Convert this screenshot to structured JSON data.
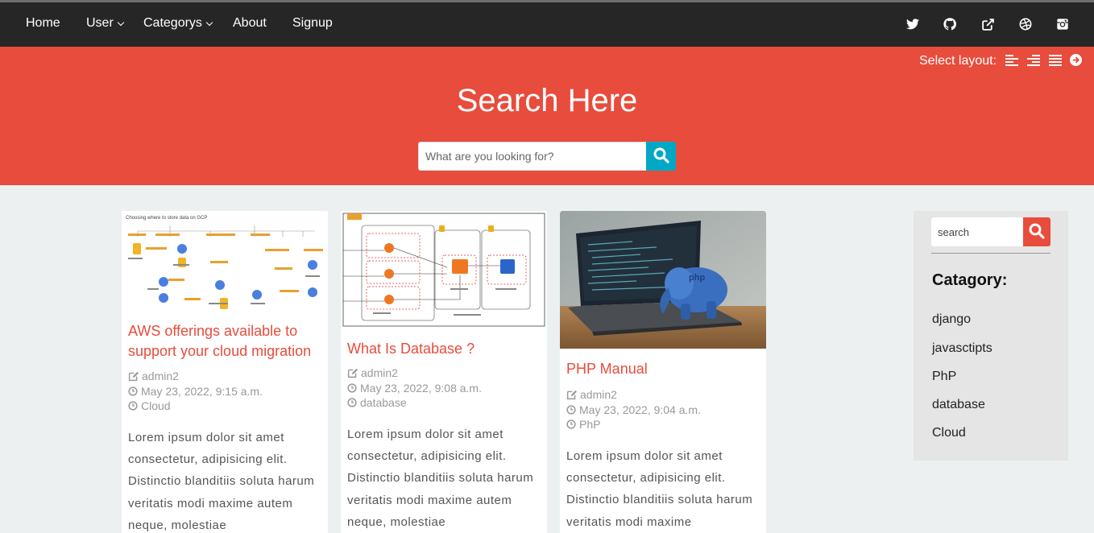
{
  "nav": {
    "items": [
      {
        "label": "Home",
        "dropdown": false
      },
      {
        "label": "User",
        "dropdown": true
      },
      {
        "label": "Categorys",
        "dropdown": true
      },
      {
        "label": "About",
        "dropdown": false
      },
      {
        "label": "Signup",
        "dropdown": false
      }
    ],
    "social_icons": [
      "twitter-icon",
      "github-icon",
      "external-link-icon",
      "dribbble-icon",
      "instagram-icon"
    ]
  },
  "hero": {
    "layout_label": "Select layout:",
    "layout_icons": [
      "align-left-icon",
      "align-right-icon",
      "align-justify-icon",
      "arrow-circle-right-icon"
    ],
    "title": "Search Here",
    "search_placeholder": "What are you looking for?",
    "search_icon": "search-icon"
  },
  "posts": [
    {
      "title": "AWS offerings available to support your cloud migration",
      "author": "admin2",
      "date": "May 23, 2022, 9:15 a.m.",
      "category": "Cloud",
      "excerpt": "Lorem ipsum dolor sit amet consectetur, adipisicing elit. Distinctio blanditiis soluta harum veritatis modi maxime autem neque, molestiae",
      "image": "gcp-data-storage-flowchart",
      "image_caption": "Choosing where to store data on GCP"
    },
    {
      "title": "What Is Database ?",
      "author": "admin2",
      "date": "May 23, 2022, 9:08 a.m.",
      "category": "database",
      "excerpt": "Lorem ipsum dolor sit amet consectetur, adipisicing elit. Distinctio blanditiis soluta harum veritatis modi maxime autem neque, molestiae",
      "image": "database-architecture-diagram"
    },
    {
      "title": "PHP Manual",
      "author": "admin2",
      "date": "May 23, 2022, 9:04 a.m.",
      "category": "PhP",
      "excerpt": "Lorem ipsum dolor sit amet consectetur, adipisicing elit. Distinctio blanditiis soluta harum veritatis modi maxime",
      "image": "php-elephant-on-laptop",
      "image_text": "php"
    }
  ],
  "sidebar": {
    "search_placeholder": "search",
    "heading": "Catagory:",
    "categories": [
      "django",
      "javasctipts",
      "PhP",
      "database",
      "Cloud"
    ]
  },
  "colors": {
    "navbar": "#262626",
    "hero": "#e74c3c",
    "accent": "#e74c3c",
    "search_button": "#00a8c6",
    "page_bg": "#ecf0f1",
    "sidebar_bg": "#e5e5e5"
  }
}
